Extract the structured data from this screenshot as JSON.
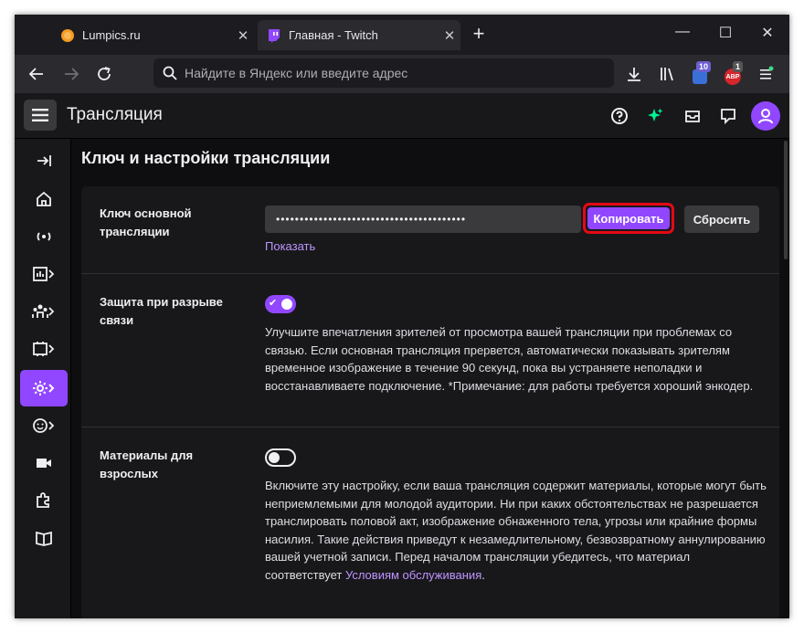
{
  "browser": {
    "tabs": [
      {
        "title": "Lumpics.ru",
        "favicon": "lumpics-orange-circle",
        "active": false
      },
      {
        "title": "Главная - Twitch",
        "favicon": "twitch-icon",
        "active": true
      }
    ],
    "address_placeholder": "Найдите в Яндекс или введите адрес",
    "extensions": {
      "badge_1": "10",
      "badge_2": "1",
      "abp_label": "ABP"
    }
  },
  "app": {
    "title": "Трансляция"
  },
  "page": {
    "title": "Ключ и настройки трансляции",
    "stream_key": {
      "label": "Ключ основной трансляции",
      "masked_value": "••••••••••••••••••••••••••••••••••••••••",
      "copy_label": "Копировать",
      "reset_label": "Сбросить",
      "show_label": "Показать"
    },
    "disconnect_protection": {
      "label": "Защита при разрыве связи",
      "enabled": true,
      "description": "Улучшите впечатления зрителей от просмотра вашей трансляции при проблемах со связью. Если основная трансляция прервется, автоматически показывать зрителям временное изображение в течение 90 секунд, пока вы устраняете неполадки и восстанавливаете подключение. *Примечание: для работы требуется хороший энкодер."
    },
    "mature_content": {
      "label": "Материалы для взрослых",
      "enabled": false,
      "description": "Включите эту настройку, если ваша трансляция содержит материалы, которые могут быть неприемлемыми для молодой аудитории. Ни при каких обстоятельствах не разрешается транслировать половой акт, изображение обнаженного тела, угрозы или крайние формы насилия. Такие действия приведут к незамедлительному, безвозвратному аннулированию вашей учетной записи. Перед началом трансляции убедитесь, что материал соответствует ",
      "link_text": "Условиям обслуживания",
      "after_link": "."
    }
  },
  "colors": {
    "accent": "#9147ff",
    "highlight": "#e50914",
    "link": "#bf94ff",
    "background": "#0e0e10",
    "panel": "#18181b"
  }
}
